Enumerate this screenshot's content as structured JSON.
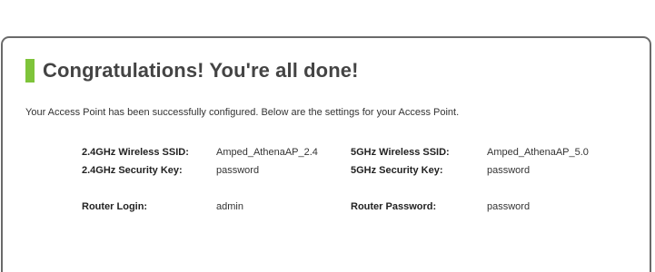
{
  "header": {
    "title": "Congratulations! You're all done!"
  },
  "intro_text": "Your Access Point has been successfully configured. Below are the settings for your Access Point.",
  "settings": {
    "ssid_24_label": "2.4GHz Wireless SSID:",
    "ssid_24_value": "Amped_AthenaAP_2.4",
    "ssid_5_label": "5GHz Wireless SSID:",
    "ssid_5_value": "Amped_AthenaAP_5.0",
    "key_24_label": "2.4GHz Security Key:",
    "key_24_value": "password",
    "key_5_label": "5GHz Security Key:",
    "key_5_value": "password",
    "router_login_label": "Router Login:",
    "router_login_value": "admin",
    "router_password_label": "Router Password:",
    "router_password_value": "password"
  },
  "colors": {
    "accent": "#7ec43a",
    "title_text": "#444444",
    "border": "#6a6a6a"
  }
}
